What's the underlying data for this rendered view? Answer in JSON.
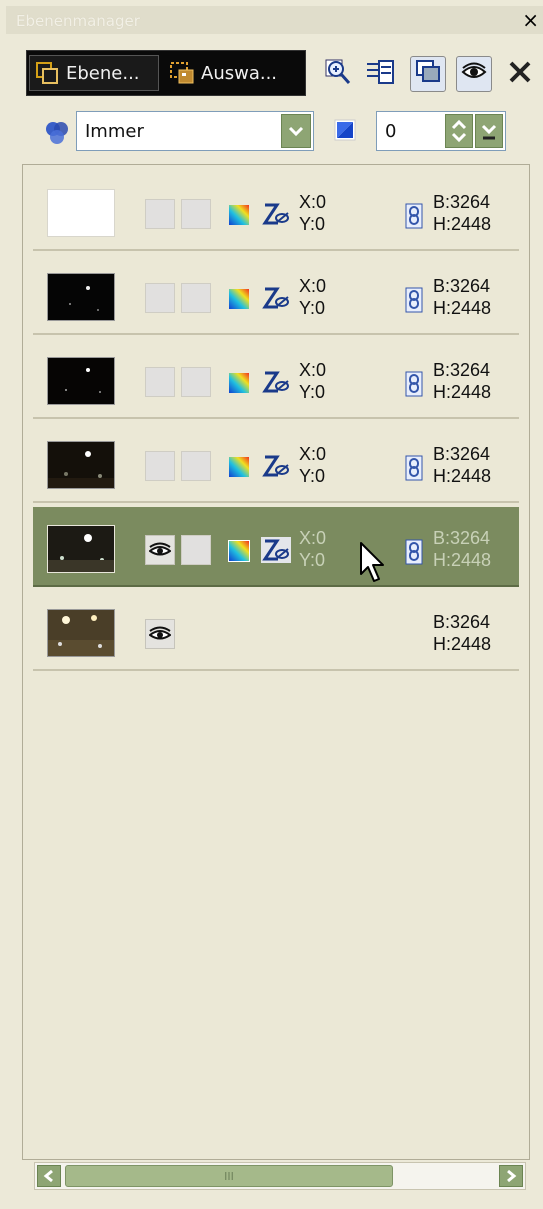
{
  "window": {
    "title": "Ebenenmanager",
    "close_label": "×"
  },
  "tabs": [
    {
      "label": "Ebene...",
      "icon": "layers-tab-icon"
    },
    {
      "label": "Auswa...",
      "icon": "selection-tab-icon"
    }
  ],
  "toolbar": {
    "icons": [
      "zoom-icon",
      "layer-properties-icon",
      "overlay-toggle-icon",
      "visibility-toggle-icon",
      "close-x-icon"
    ]
  },
  "blend": {
    "mode": "Immer",
    "opacity": "0"
  },
  "layers": [
    {
      "thumb": "white",
      "visible": false,
      "x": "X:0",
      "y": "Y:0",
      "linked": true,
      "w": "B:3264",
      "h": "H:2448",
      "selected": false
    },
    {
      "thumb": "dark",
      "visible": false,
      "x": "X:0",
      "y": "Y:0",
      "linked": true,
      "w": "B:3264",
      "h": "H:2448",
      "selected": false
    },
    {
      "thumb": "dark",
      "visible": false,
      "x": "X:0",
      "y": "Y:0",
      "linked": true,
      "w": "B:3264",
      "h": "H:2448",
      "selected": false
    },
    {
      "thumb": "dim",
      "visible": false,
      "x": "X:0",
      "y": "Y:0",
      "linked": true,
      "w": "B:3264",
      "h": "H:2448",
      "selected": false
    },
    {
      "thumb": "night",
      "visible": true,
      "x": "X:0",
      "y": "Y:0",
      "linked": true,
      "w": "B:3264",
      "h": "H:2448",
      "selected": true
    },
    {
      "thumb": "warm",
      "visible": true,
      "x": "",
      "y": "",
      "linked": false,
      "w": "B:3264",
      "h": "H:2448",
      "selected": false
    }
  ],
  "scrollbar": {
    "thumb_grip": "III"
  },
  "colors": {
    "panel": "#ece9d8",
    "selected_row": "#7b8b5f",
    "accent_green": "#8ea574"
  }
}
